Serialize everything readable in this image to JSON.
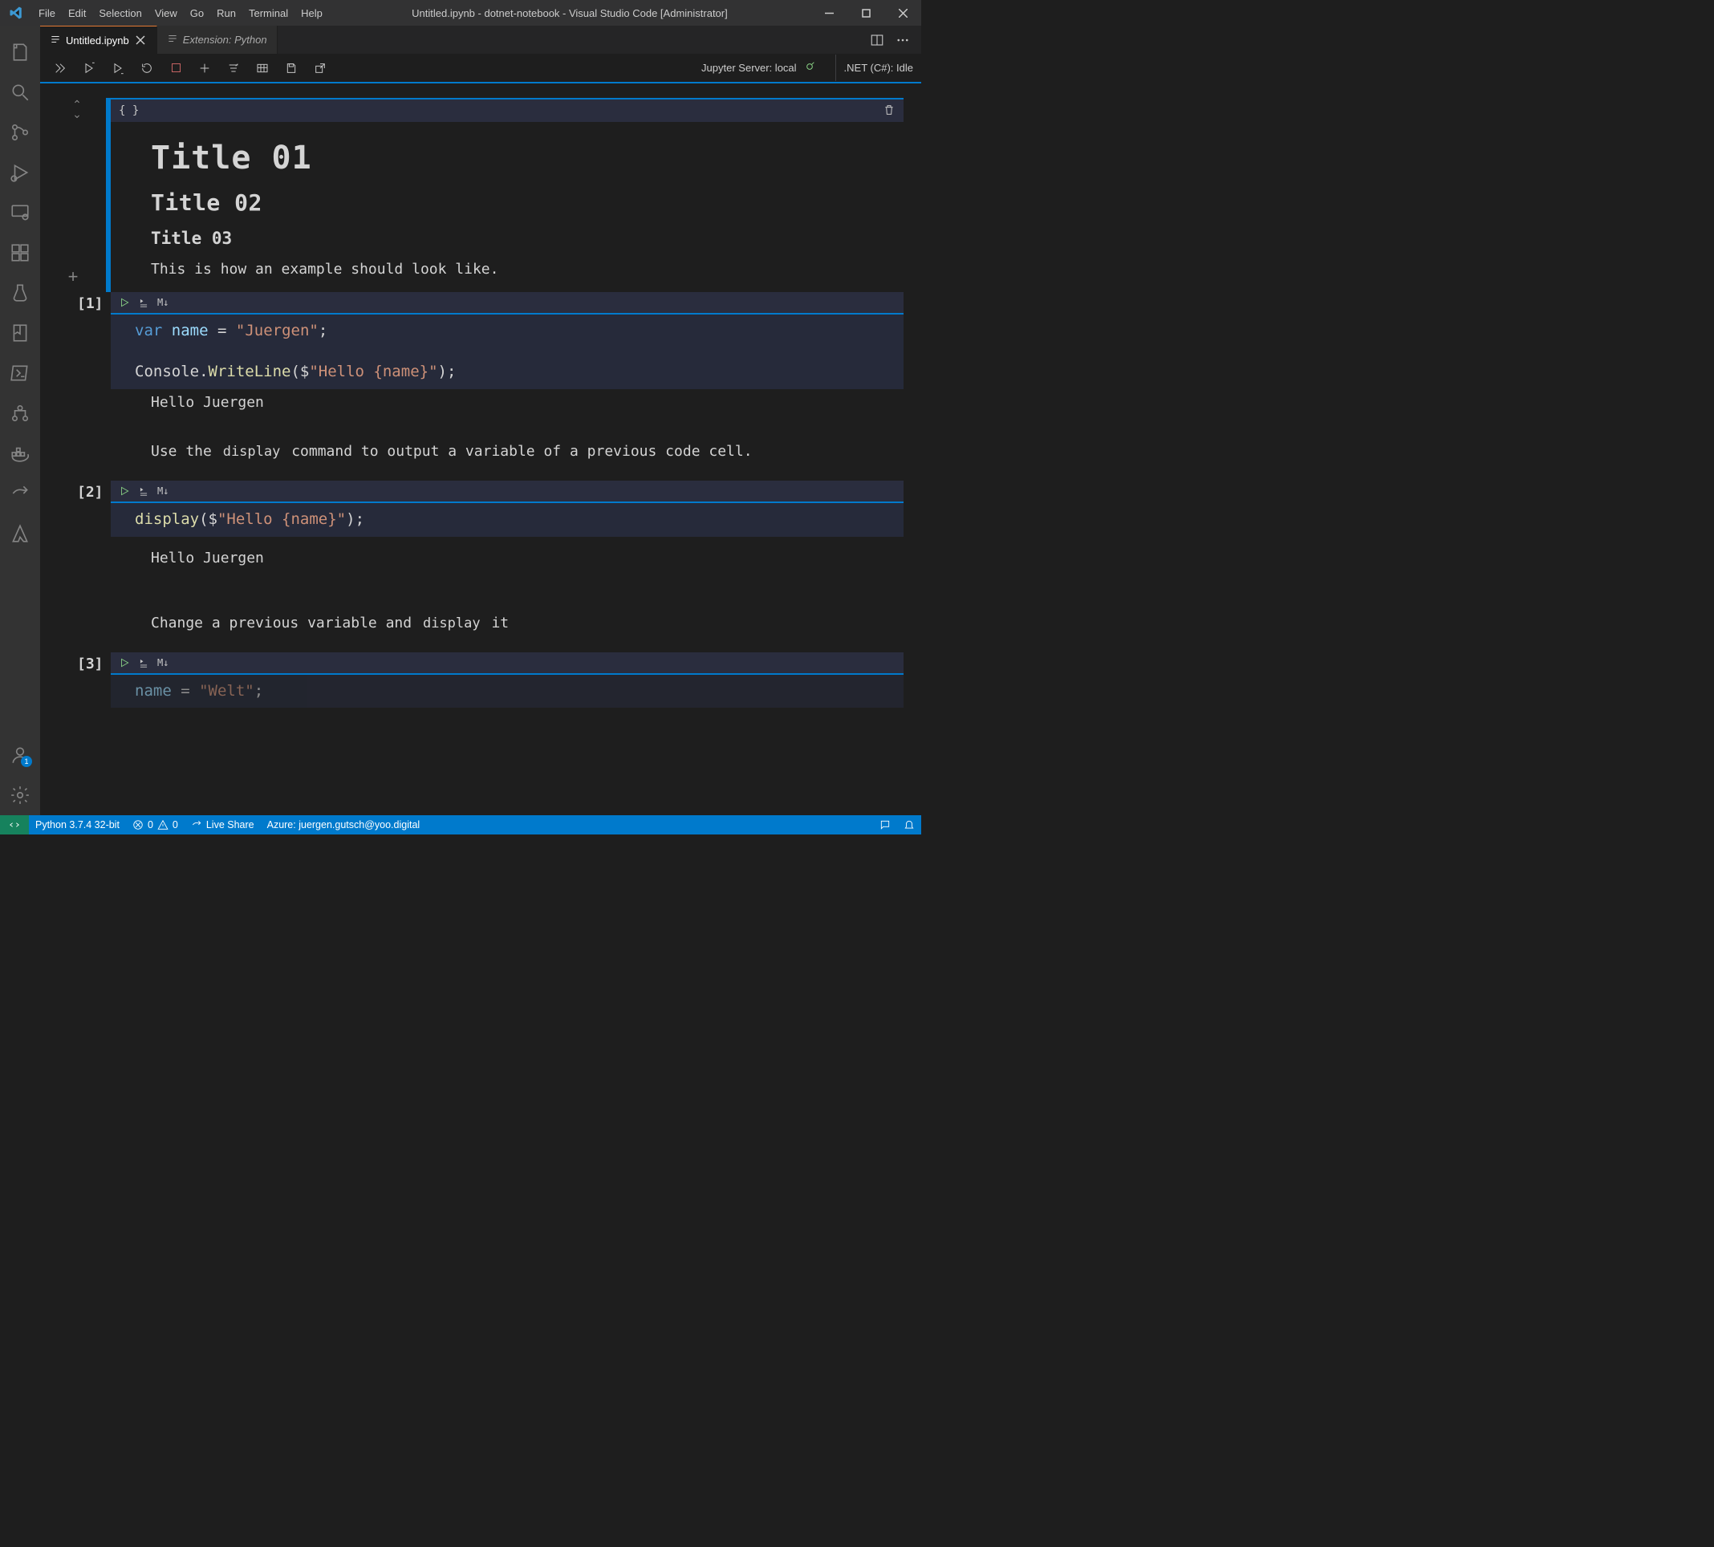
{
  "window": {
    "title": "Untitled.ipynb - dotnet-notebook - Visual Studio Code [Administrator]"
  },
  "menu": [
    "File",
    "Edit",
    "Selection",
    "View",
    "Go",
    "Run",
    "Terminal",
    "Help"
  ],
  "tabs": [
    {
      "label": "Untitled.ipynb",
      "active": true,
      "closable": true
    },
    {
      "label": "Extension: Python",
      "active": false,
      "italic": true
    }
  ],
  "notebook_toolbar": {
    "server_label": "Jupyter Server: local",
    "kernel_label": ".NET (C#): Idle"
  },
  "markdown_cell": {
    "toolbar_symbol": "{ }",
    "h1": "Title 01",
    "h2": "Title 02",
    "h3": "Title 03",
    "paragraph": "This is how an example should look like."
  },
  "code_cells": [
    {
      "exec_label": "[1]",
      "md_tag": "M↓",
      "code_html": "<span class='kw'>var</span> <span class='var'>name</span> = <span class='str'>\"Juergen\"</span>;\n\nConsole.<span class='fn'>WriteLine</span>($<span class='str'>\"Hello {name}\"</span>);",
      "output": "Hello Juergen"
    },
    {
      "exec_label": "[2]",
      "md_tag": "M↓",
      "code_html": "<span class='fn'>display</span>($<span class='str'>\"Hello {name}\"</span>);",
      "output": "Hello Juergen"
    },
    {
      "exec_label": "[3]",
      "md_tag": "M↓",
      "code_html": "<span class='var'>name</span> = <span class='str'>\"Welt\"</span>;",
      "output": ""
    }
  ],
  "between_markdown": [
    {
      "pre": "Use the ",
      "code": "display",
      "post": " command to output a variable of a previous code cell."
    },
    {
      "pre": "Change a previous variable and ",
      "code": "display",
      "post": " it"
    }
  ],
  "statusbar": {
    "python": "Python 3.7.4 32-bit",
    "errors": "0",
    "warnings": "0",
    "live_share": "Live Share",
    "azure": "Azure: juergen.gutsch@yoo.digital"
  },
  "accounts_badge": "1"
}
